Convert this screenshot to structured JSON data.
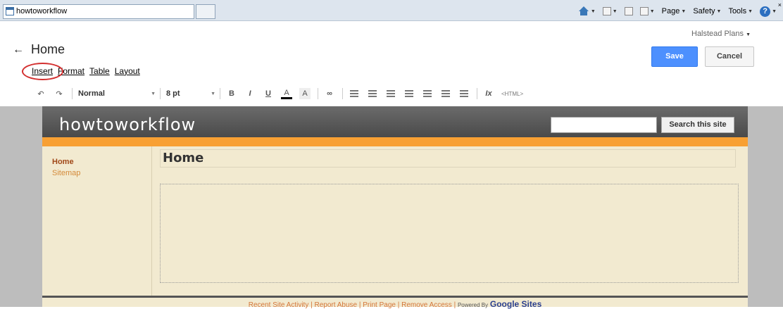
{
  "browser": {
    "tab_title": "howtoworkflow",
    "commands": [
      "Page",
      "Safety",
      "Tools"
    ]
  },
  "editor": {
    "owner": "Halstead Plans",
    "page_title": "Home",
    "save_label": "Save",
    "cancel_label": "Cancel",
    "menu": [
      "Insert",
      "Format",
      "Table",
      "Layout"
    ],
    "toolbar": {
      "style": "Normal",
      "font_size": "8 pt",
      "bold": "B",
      "italic": "I",
      "underline": "U",
      "text_color": "A",
      "highlight": "A",
      "remove_format": "Ix",
      "html": "<HTML>"
    }
  },
  "site": {
    "title": "howtoworkflow",
    "search_button": "Search this site",
    "nav": [
      "Home",
      "Sitemap"
    ],
    "heading": "Home",
    "footer": {
      "links": [
        "Recent Site Activity",
        "Report Abuse",
        "Print Page",
        "Remove Access"
      ],
      "powered_by": "Powered By",
      "brand": "Google Sites"
    }
  },
  "colors": {
    "accent_blue": "#4d90fe",
    "site_orange": "#f8a033",
    "site_header": "#555555",
    "highlight_circle": "#d32f2f"
  }
}
